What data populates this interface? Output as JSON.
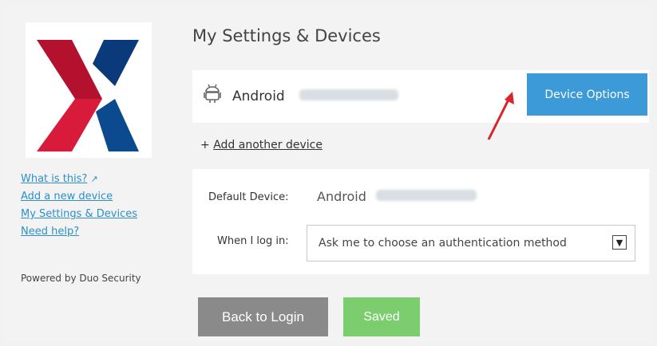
{
  "sidebar": {
    "links": [
      {
        "label": "What is this?"
      },
      {
        "label": "Add a new device"
      },
      {
        "label": "My Settings & Devices"
      },
      {
        "label": "Need help?"
      }
    ],
    "powered_by": "Powered by Duo Security",
    "logo_icon": "x-logo-icon",
    "external_icon": "external-link-icon"
  },
  "main": {
    "title": "My Settings & Devices",
    "device": {
      "icon": "android-icon",
      "name": "Android",
      "options_button": "Device Options"
    },
    "add_device": {
      "prefix": "+",
      "label": "Add another device"
    },
    "settings": {
      "default_label": "Default Device:",
      "default_value": "Android",
      "login_label": "When I log in:",
      "login_selected": "Ask me to choose an authentication method"
    }
  },
  "footer": {
    "back_button": "Back to Login",
    "saved_button": "Saved"
  },
  "colors": {
    "accent_blue": "#3c9ad8",
    "link_blue": "#2e8fc8",
    "saved_green": "#7ccd6e",
    "back_gray": "#8a8a8a",
    "logo_red": "#c8102e",
    "logo_navy": "#0a3a7a",
    "annotation_arrow": "#d8252b"
  }
}
